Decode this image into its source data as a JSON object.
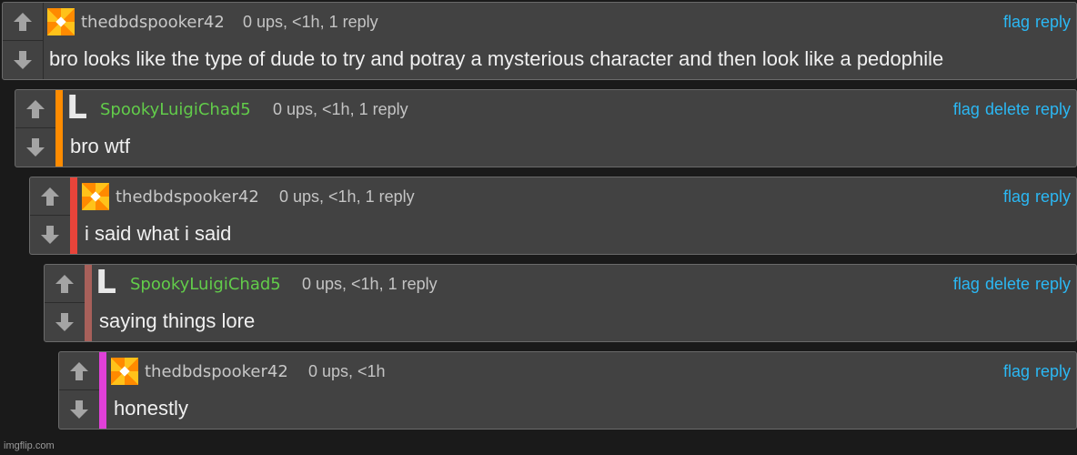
{
  "comments": [
    {
      "username": "thedbdspooker42",
      "meta": "0 ups, <1h, 1 reply",
      "actions": [
        "flag",
        "reply"
      ],
      "text": "bro looks like the type of dude to try and potray a mysterious character and then look like a pedophile",
      "avatar": "pinwheel-avatar",
      "depth_color": ""
    },
    {
      "username": "SpookyLuigiChad5",
      "meta": "0 ups, <1h, 1 reply",
      "actions": [
        "flag",
        "delete",
        "reply"
      ],
      "text": "bro wtf",
      "avatar": "L-avatar",
      "depth_color": "#ff8c00"
    },
    {
      "username": "thedbdspooker42",
      "meta": "0 ups, <1h, 1 reply",
      "actions": [
        "flag",
        "reply"
      ],
      "text": "i said what i said",
      "avatar": "pinwheel-avatar",
      "depth_color": "#e8443a"
    },
    {
      "username": "SpookyLuigiChad5",
      "meta": "0 ups, <1h, 1 reply",
      "actions": [
        "flag",
        "delete",
        "reply"
      ],
      "text": "saying things lore",
      "avatar": "L-avatar",
      "depth_color": "#a8605a"
    },
    {
      "username": "thedbdspooker42",
      "meta": "0 ups, <1h",
      "actions": [
        "flag",
        "reply"
      ],
      "text": "honestly",
      "avatar": "pinwheel-avatar",
      "depth_color": "#e040d8"
    }
  ],
  "avatar_letter": "L",
  "watermark": "imgflip.com",
  "colors": {
    "link": "#2bb8f4",
    "username_green": "#62cc4a",
    "background": "#1a1a1a",
    "panel": "#424242"
  }
}
